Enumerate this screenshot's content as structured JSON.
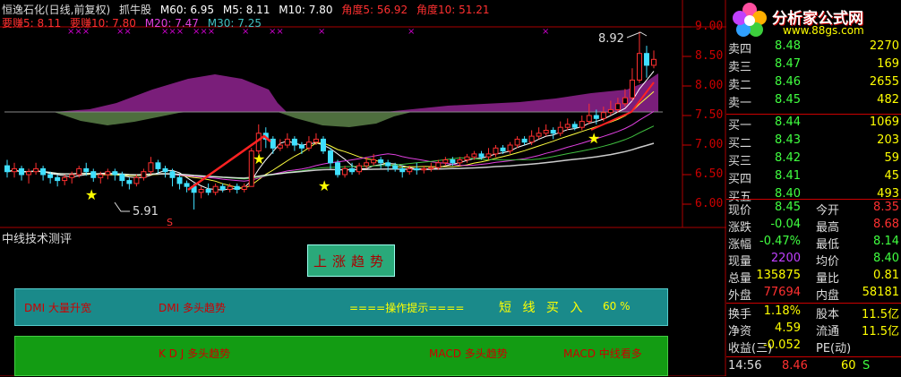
{
  "indicator_header": {
    "title": "恒逸石化(日线,前复权)",
    "name": "抓牛股",
    "m60": "M60: 6.95",
    "m5": "M5: 8.11",
    "m10": "M10: 7.80",
    "jiaodu5": "角度5: 56.92",
    "jiaodu10": "角度10: 51.21"
  },
  "ma_header": {
    "yaozhuan5": "要赚5: 8.11",
    "yaozhuan10": "要赚10: 7.80",
    "m20": "M20: 7.47",
    "m30": "M30: 7.25"
  },
  "price_axis": [
    "9.00",
    "8.50",
    "8.00",
    "7.50",
    "7.00",
    "6.50",
    "6.00"
  ],
  "annotations": {
    "high": "8.92",
    "low": "5.91",
    "s_mark": "S"
  },
  "evaluation": {
    "title": "中线技术测评",
    "trend_button": "上涨趋势",
    "panel1": {
      "dmi1": "DMI 大量升宽",
      "dmi2": "DMI 多头趋势",
      "hint": "====操作提示====",
      "advice": "短 线 买 入",
      "percent": "60 %"
    },
    "panel2": {
      "kdj": "K D J 多头趋势",
      "macd1": "MACD 多头趋势",
      "macd2": "MACD 中线看多"
    }
  },
  "logo": {
    "name": "分析家公式网",
    "url": "www.88gs.com"
  },
  "order_book": {
    "sell": [
      {
        "label": "卖四",
        "price": "8.48",
        "vol": "2270"
      },
      {
        "label": "卖三",
        "price": "8.47",
        "vol": "169"
      },
      {
        "label": "卖二",
        "price": "8.46",
        "vol": "2655"
      },
      {
        "label": "卖一",
        "price": "8.45",
        "vol": "482"
      }
    ],
    "buy": [
      {
        "label": "买一",
        "price": "8.44",
        "vol": "1069"
      },
      {
        "label": "买二",
        "price": "8.43",
        "vol": "203"
      },
      {
        "label": "买三",
        "price": "8.42",
        "vol": "59"
      },
      {
        "label": "买四",
        "price": "8.41",
        "vol": "45"
      },
      {
        "label": "买五",
        "price": "8.40",
        "vol": "493"
      }
    ]
  },
  "quote": [
    {
      "l1": "现价",
      "v1": "8.45",
      "l2": "今开",
      "v2": "8.35"
    },
    {
      "l1": "涨跌",
      "v1": "-0.04",
      "l2": "最高",
      "v2": "8.68"
    },
    {
      "l1": "涨幅",
      "v1": "-0.47%",
      "l2": "最低",
      "v2": "8.14"
    },
    {
      "l1": "现量",
      "v1": "2200",
      "l2": "均价",
      "v2": "8.40"
    },
    {
      "l1": "总量",
      "v1": "135875",
      "l2": "量比",
      "v2": "0.81"
    },
    {
      "l1": "外盘",
      "v1": "77694",
      "l2": "内盘",
      "v2": "58181"
    }
  ],
  "stats": [
    {
      "l1": "换手",
      "v1": "1.18%",
      "l2": "股本",
      "v2": "11.5亿"
    },
    {
      "l1": "净资",
      "v1": "4.59",
      "l2": "流通",
      "v2": "11.5亿"
    },
    {
      "l1": "收益(三)",
      "v1": "-0.052",
      "l2": "PE(动)",
      "v2": ""
    }
  ],
  "tick": {
    "time": "14:56",
    "price": "8.46",
    "vol": "60",
    "flag": "S"
  },
  "chart_data": {
    "type": "candlestick",
    "title": "恒逸石化(日线,前复权)",
    "ylim": [
      5.8,
      9.05
    ],
    "y_ticks": [
      6.0,
      6.5,
      7.0,
      7.5,
      8.0,
      8.5,
      9.0
    ],
    "candles": [
      [
        6.65,
        6.55,
        6.75,
        6.45
      ],
      [
        6.55,
        6.6,
        6.7,
        6.45
      ],
      [
        6.6,
        6.5,
        6.65,
        6.4
      ],
      [
        6.5,
        6.55,
        6.6,
        6.35
      ],
      [
        6.55,
        6.6,
        6.7,
        6.5
      ],
      [
        6.6,
        6.5,
        6.65,
        6.4
      ],
      [
        6.5,
        6.45,
        6.55,
        6.35
      ],
      [
        6.45,
        6.4,
        6.5,
        6.3
      ],
      [
        6.4,
        6.45,
        6.5,
        6.32
      ],
      [
        6.45,
        6.5,
        6.55,
        6.35
      ],
      [
        6.5,
        6.6,
        6.65,
        6.45
      ],
      [
        6.6,
        6.55,
        6.7,
        6.48
      ],
      [
        6.55,
        6.45,
        6.6,
        6.38
      ],
      [
        6.45,
        6.5,
        6.55,
        6.35
      ],
      [
        6.5,
        6.55,
        6.6,
        6.42
      ],
      [
        6.55,
        6.5,
        6.6,
        6.4
      ],
      [
        6.5,
        6.4,
        6.55,
        6.3
      ],
      [
        6.4,
        6.35,
        6.45,
        6.25
      ],
      [
        6.35,
        6.45,
        6.5,
        6.3
      ],
      [
        6.45,
        6.55,
        6.6,
        6.4
      ],
      [
        6.55,
        6.7,
        6.8,
        6.5
      ],
      [
        6.7,
        6.6,
        6.75,
        6.52
      ],
      [
        6.6,
        6.55,
        6.65,
        6.45
      ],
      [
        6.55,
        6.45,
        6.6,
        6.3
      ],
      [
        6.45,
        6.35,
        6.5,
        6.25
      ],
      [
        6.35,
        6.3,
        6.4,
        6.2
      ],
      [
        6.3,
        6.2,
        6.35,
        5.91
      ],
      [
        6.2,
        6.25,
        6.3,
        6.1
      ],
      [
        6.25,
        6.2,
        6.35,
        6.15
      ],
      [
        6.2,
        6.3,
        6.35,
        6.15
      ],
      [
        6.3,
        6.25,
        6.35,
        6.2
      ],
      [
        6.25,
        6.3,
        6.35,
        6.2
      ],
      [
        6.3,
        6.25,
        6.35,
        6.18
      ],
      [
        6.25,
        6.3,
        6.35,
        6.2
      ],
      [
        6.3,
        6.9,
        6.95,
        6.3
      ],
      [
        6.9,
        7.2,
        7.35,
        6.85
      ],
      [
        7.2,
        7.1,
        7.3,
        6.95
      ],
      [
        7.1,
        6.95,
        7.15,
        6.85
      ],
      [
        6.95,
        7.0,
        7.1,
        6.9
      ],
      [
        7.0,
        7.1,
        7.2,
        6.95
      ],
      [
        7.1,
        7.0,
        7.15,
        6.9
      ],
      [
        7.0,
        6.95,
        7.05,
        6.85
      ],
      [
        6.95,
        7.05,
        7.15,
        6.9
      ],
      [
        7.05,
        7.1,
        7.2,
        7.0
      ],
      [
        7.1,
        6.9,
        7.15,
        6.85
      ],
      [
        6.9,
        6.7,
        6.95,
        6.6
      ],
      [
        6.7,
        6.5,
        6.75,
        6.45
      ],
      [
        6.5,
        6.6,
        6.65,
        6.45
      ],
      [
        6.6,
        6.55,
        6.7,
        6.5
      ],
      [
        6.55,
        6.65,
        6.7,
        6.5
      ],
      [
        6.65,
        6.7,
        6.8,
        6.6
      ],
      [
        6.7,
        6.75,
        6.85,
        6.65
      ],
      [
        6.75,
        6.7,
        6.8,
        6.6
      ],
      [
        6.7,
        6.65,
        6.75,
        6.55
      ],
      [
        6.65,
        6.6,
        6.7,
        6.55
      ],
      [
        6.6,
        6.55,
        6.65,
        6.45
      ],
      [
        6.55,
        6.6,
        6.65,
        6.5
      ],
      [
        6.6,
        6.58,
        6.7,
        6.5
      ],
      [
        6.58,
        6.6,
        6.65,
        6.52
      ],
      [
        6.6,
        6.62,
        6.7,
        6.55
      ],
      [
        6.62,
        6.7,
        6.75,
        6.58
      ],
      [
        6.7,
        6.75,
        6.8,
        6.65
      ],
      [
        6.75,
        6.7,
        6.8,
        6.65
      ],
      [
        6.7,
        6.75,
        6.8,
        6.65
      ],
      [
        6.75,
        6.8,
        6.85,
        6.7
      ],
      [
        6.8,
        6.85,
        6.9,
        6.75
      ],
      [
        6.85,
        6.8,
        6.9,
        6.75
      ],
      [
        6.8,
        6.85,
        6.95,
        6.75
      ],
      [
        6.85,
        6.95,
        7.0,
        6.8
      ],
      [
        6.95,
        6.9,
        7.0,
        6.85
      ],
      [
        6.9,
        7.0,
        7.05,
        6.85
      ],
      [
        7.0,
        7.1,
        7.15,
        6.95
      ],
      [
        7.1,
        7.05,
        7.15,
        7.0
      ],
      [
        7.05,
        7.15,
        7.25,
        7.0
      ],
      [
        7.15,
        7.2,
        7.3,
        7.1
      ],
      [
        7.2,
        7.25,
        7.35,
        7.15
      ],
      [
        7.25,
        7.2,
        7.3,
        7.1
      ],
      [
        7.2,
        7.3,
        7.4,
        7.15
      ],
      [
        7.3,
        7.35,
        7.45,
        7.25
      ],
      [
        7.35,
        7.3,
        7.4,
        7.25
      ],
      [
        7.3,
        7.4,
        7.5,
        7.25
      ],
      [
        7.4,
        7.5,
        7.7,
        7.35
      ],
      [
        7.5,
        7.45,
        7.6,
        7.35
      ],
      [
        7.45,
        7.55,
        7.65,
        7.4
      ],
      [
        7.55,
        7.6,
        7.75,
        7.5
      ],
      [
        7.6,
        7.7,
        7.8,
        7.55
      ],
      [
        7.7,
        7.8,
        7.95,
        7.65
      ],
      [
        7.8,
        8.1,
        8.3,
        7.75
      ],
      [
        8.1,
        8.55,
        8.92,
        8.05
      ],
      [
        8.55,
        8.35,
        8.68,
        8.14
      ],
      [
        8.35,
        8.45,
        8.6,
        8.3
      ]
    ]
  }
}
